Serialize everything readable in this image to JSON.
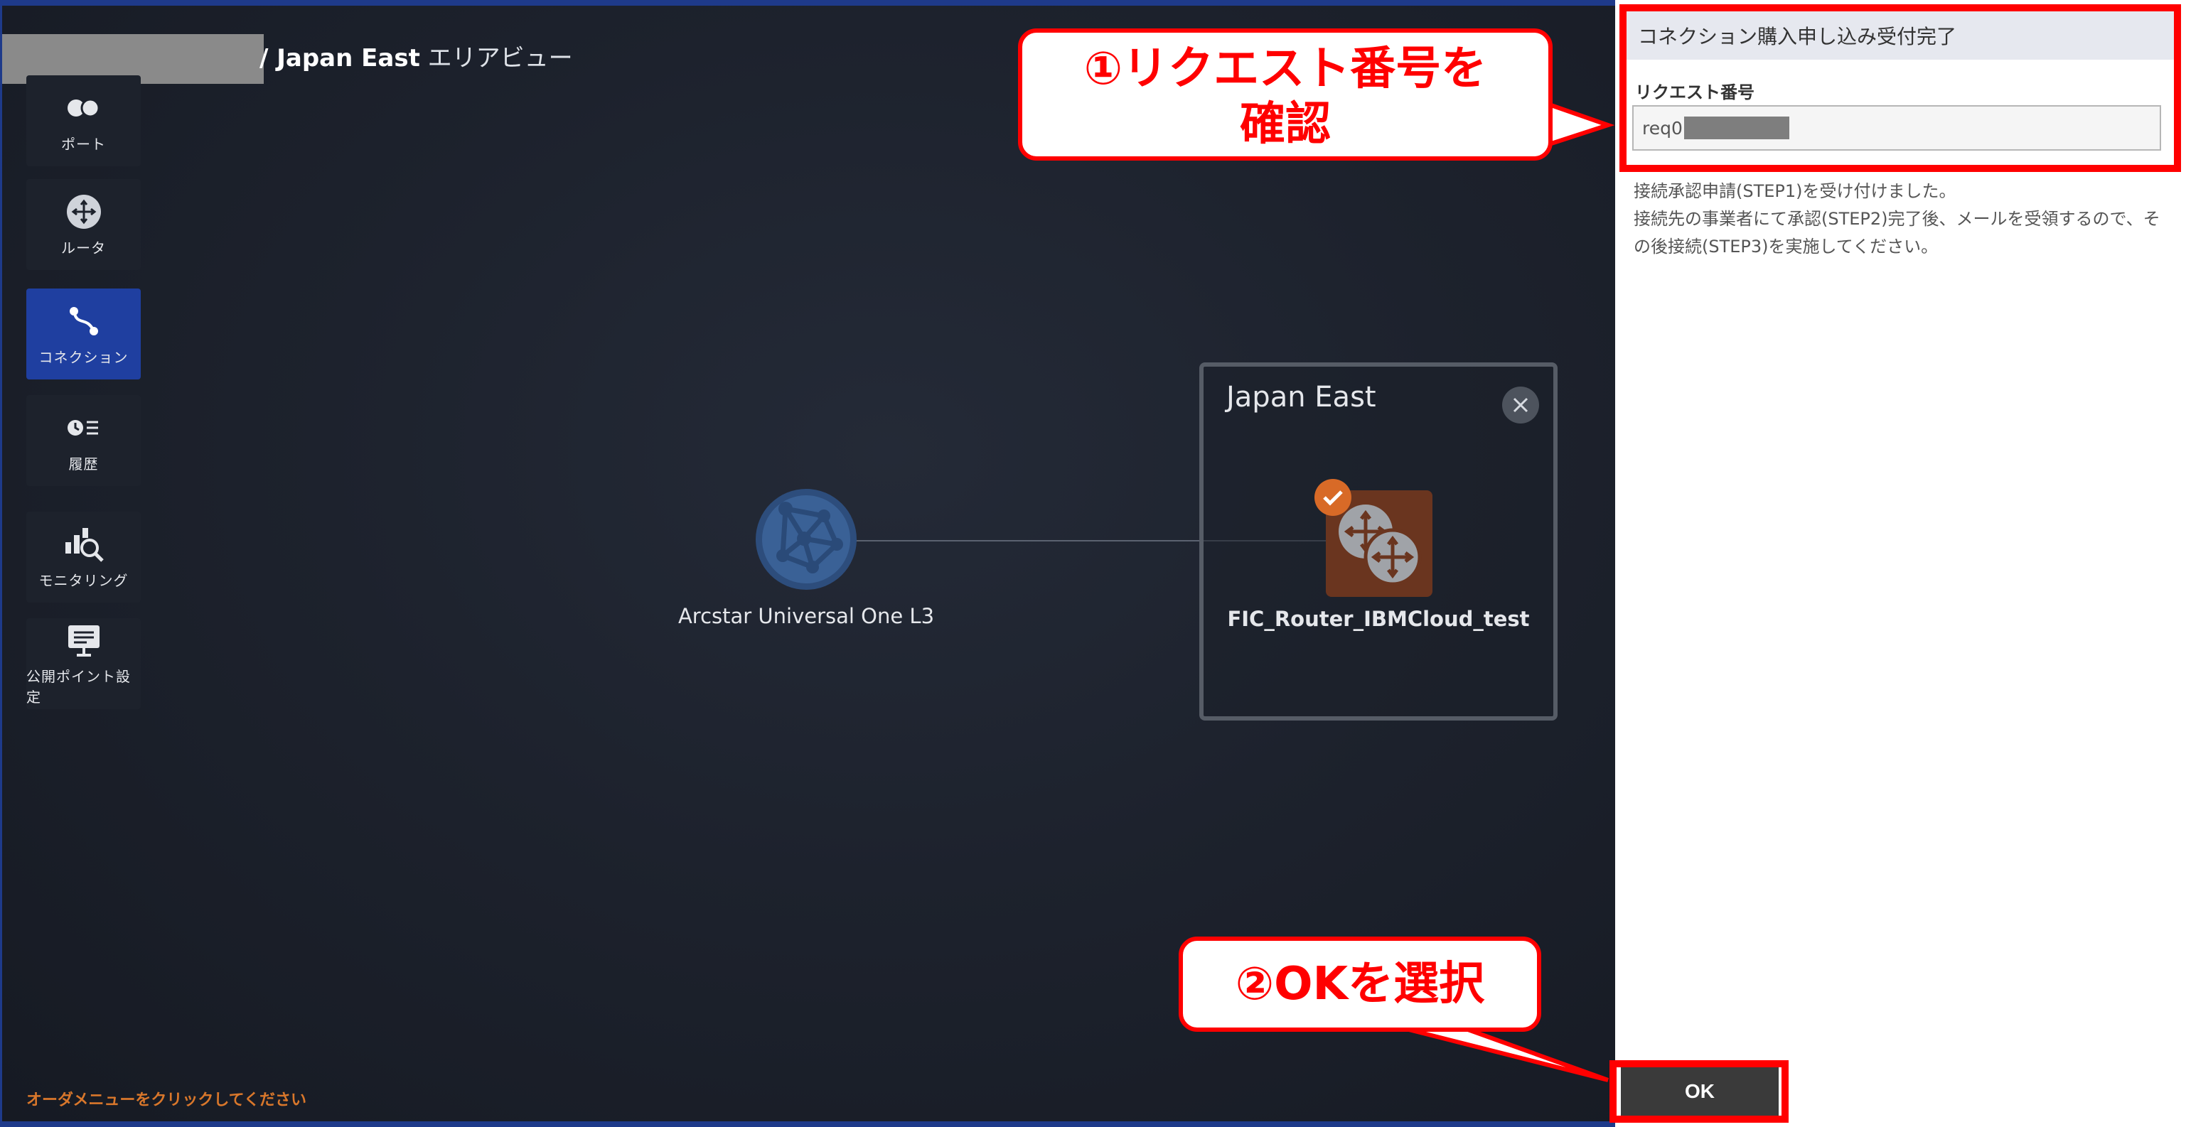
{
  "breadcrumb": {
    "region": "/ Japan East",
    "view": " エリアビュー"
  },
  "menu": {
    "items": [
      {
        "label": "ポート",
        "icon": "port-icon"
      },
      {
        "label": "ルータ",
        "icon": "router-icon"
      },
      {
        "label": "コネクション",
        "icon": "connection-icon",
        "active": true
      },
      {
        "label": "履歴",
        "icon": "history-icon"
      },
      {
        "label": "モニタリング",
        "icon": "monitoring-icon"
      },
      {
        "label": "公開ポイント設定",
        "icon": "public-point-icon"
      }
    ]
  },
  "footer_hint": "オーダメニューをクリックしてください",
  "map": {
    "globe_label": "Arcstar Universal One L3",
    "area_title": "Japan East",
    "router_label": "FIC_Router_IBMCloud_test"
  },
  "panel": {
    "header": "コネクション購入申し込み受付完了",
    "field_label": "リクエスト番号",
    "field_value": "req0",
    "message_1": "接続承認申請(STEP1)を受け付けました。",
    "message_2": "接続先の事業者にて承認(STEP2)完了後、メールを受領するので、その後接続(STEP3)を実施してください。",
    "ok_label": "OK"
  },
  "callouts": {
    "step1_line1": "①リクエスト番号を",
    "step1_line2": "確認",
    "step2": "②OKを選択"
  },
  "colors": {
    "highlight": "#ff0000",
    "active_menu": "#1f3fa0",
    "router_tile": "#6a351f",
    "hint_text": "#d9772b"
  }
}
